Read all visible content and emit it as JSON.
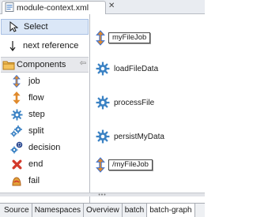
{
  "editor_tab": {
    "title": "module-context.xml",
    "icon": "xml-file-icon",
    "close": "✕"
  },
  "palette": {
    "select_label": "Select",
    "next_reference_label": "next reference",
    "drawer_label": "Components",
    "drawer_toggle": "⇦",
    "tools": [
      {
        "label": "job",
        "icon": "job-icon"
      },
      {
        "label": "flow",
        "icon": "flow-icon"
      },
      {
        "label": "step",
        "icon": "step-gear-icon"
      },
      {
        "label": "split",
        "icon": "split-icon"
      },
      {
        "label": "decision",
        "icon": "decision-icon"
      },
      {
        "label": "end",
        "icon": "end-icon"
      },
      {
        "label": "fail",
        "icon": "fail-icon"
      }
    ]
  },
  "canvas": {
    "job_start": "myFileJob",
    "steps": [
      "loadFileData",
      "processFile",
      "persistMyData"
    ],
    "job_end": "/myFileJob"
  },
  "bottom_tabs": [
    "Source",
    "Namespaces",
    "Overview",
    "batch",
    "batch-graph"
  ],
  "active_bottom_tab": "batch-graph",
  "colors": {
    "selection": "#dbe7f7",
    "job_orange": "#e08a2c",
    "job_blue": "#3a6fcf",
    "gear_blue": "#3b82c4",
    "end_red": "#d33a2c",
    "folder_orange": "#f0a63a"
  }
}
